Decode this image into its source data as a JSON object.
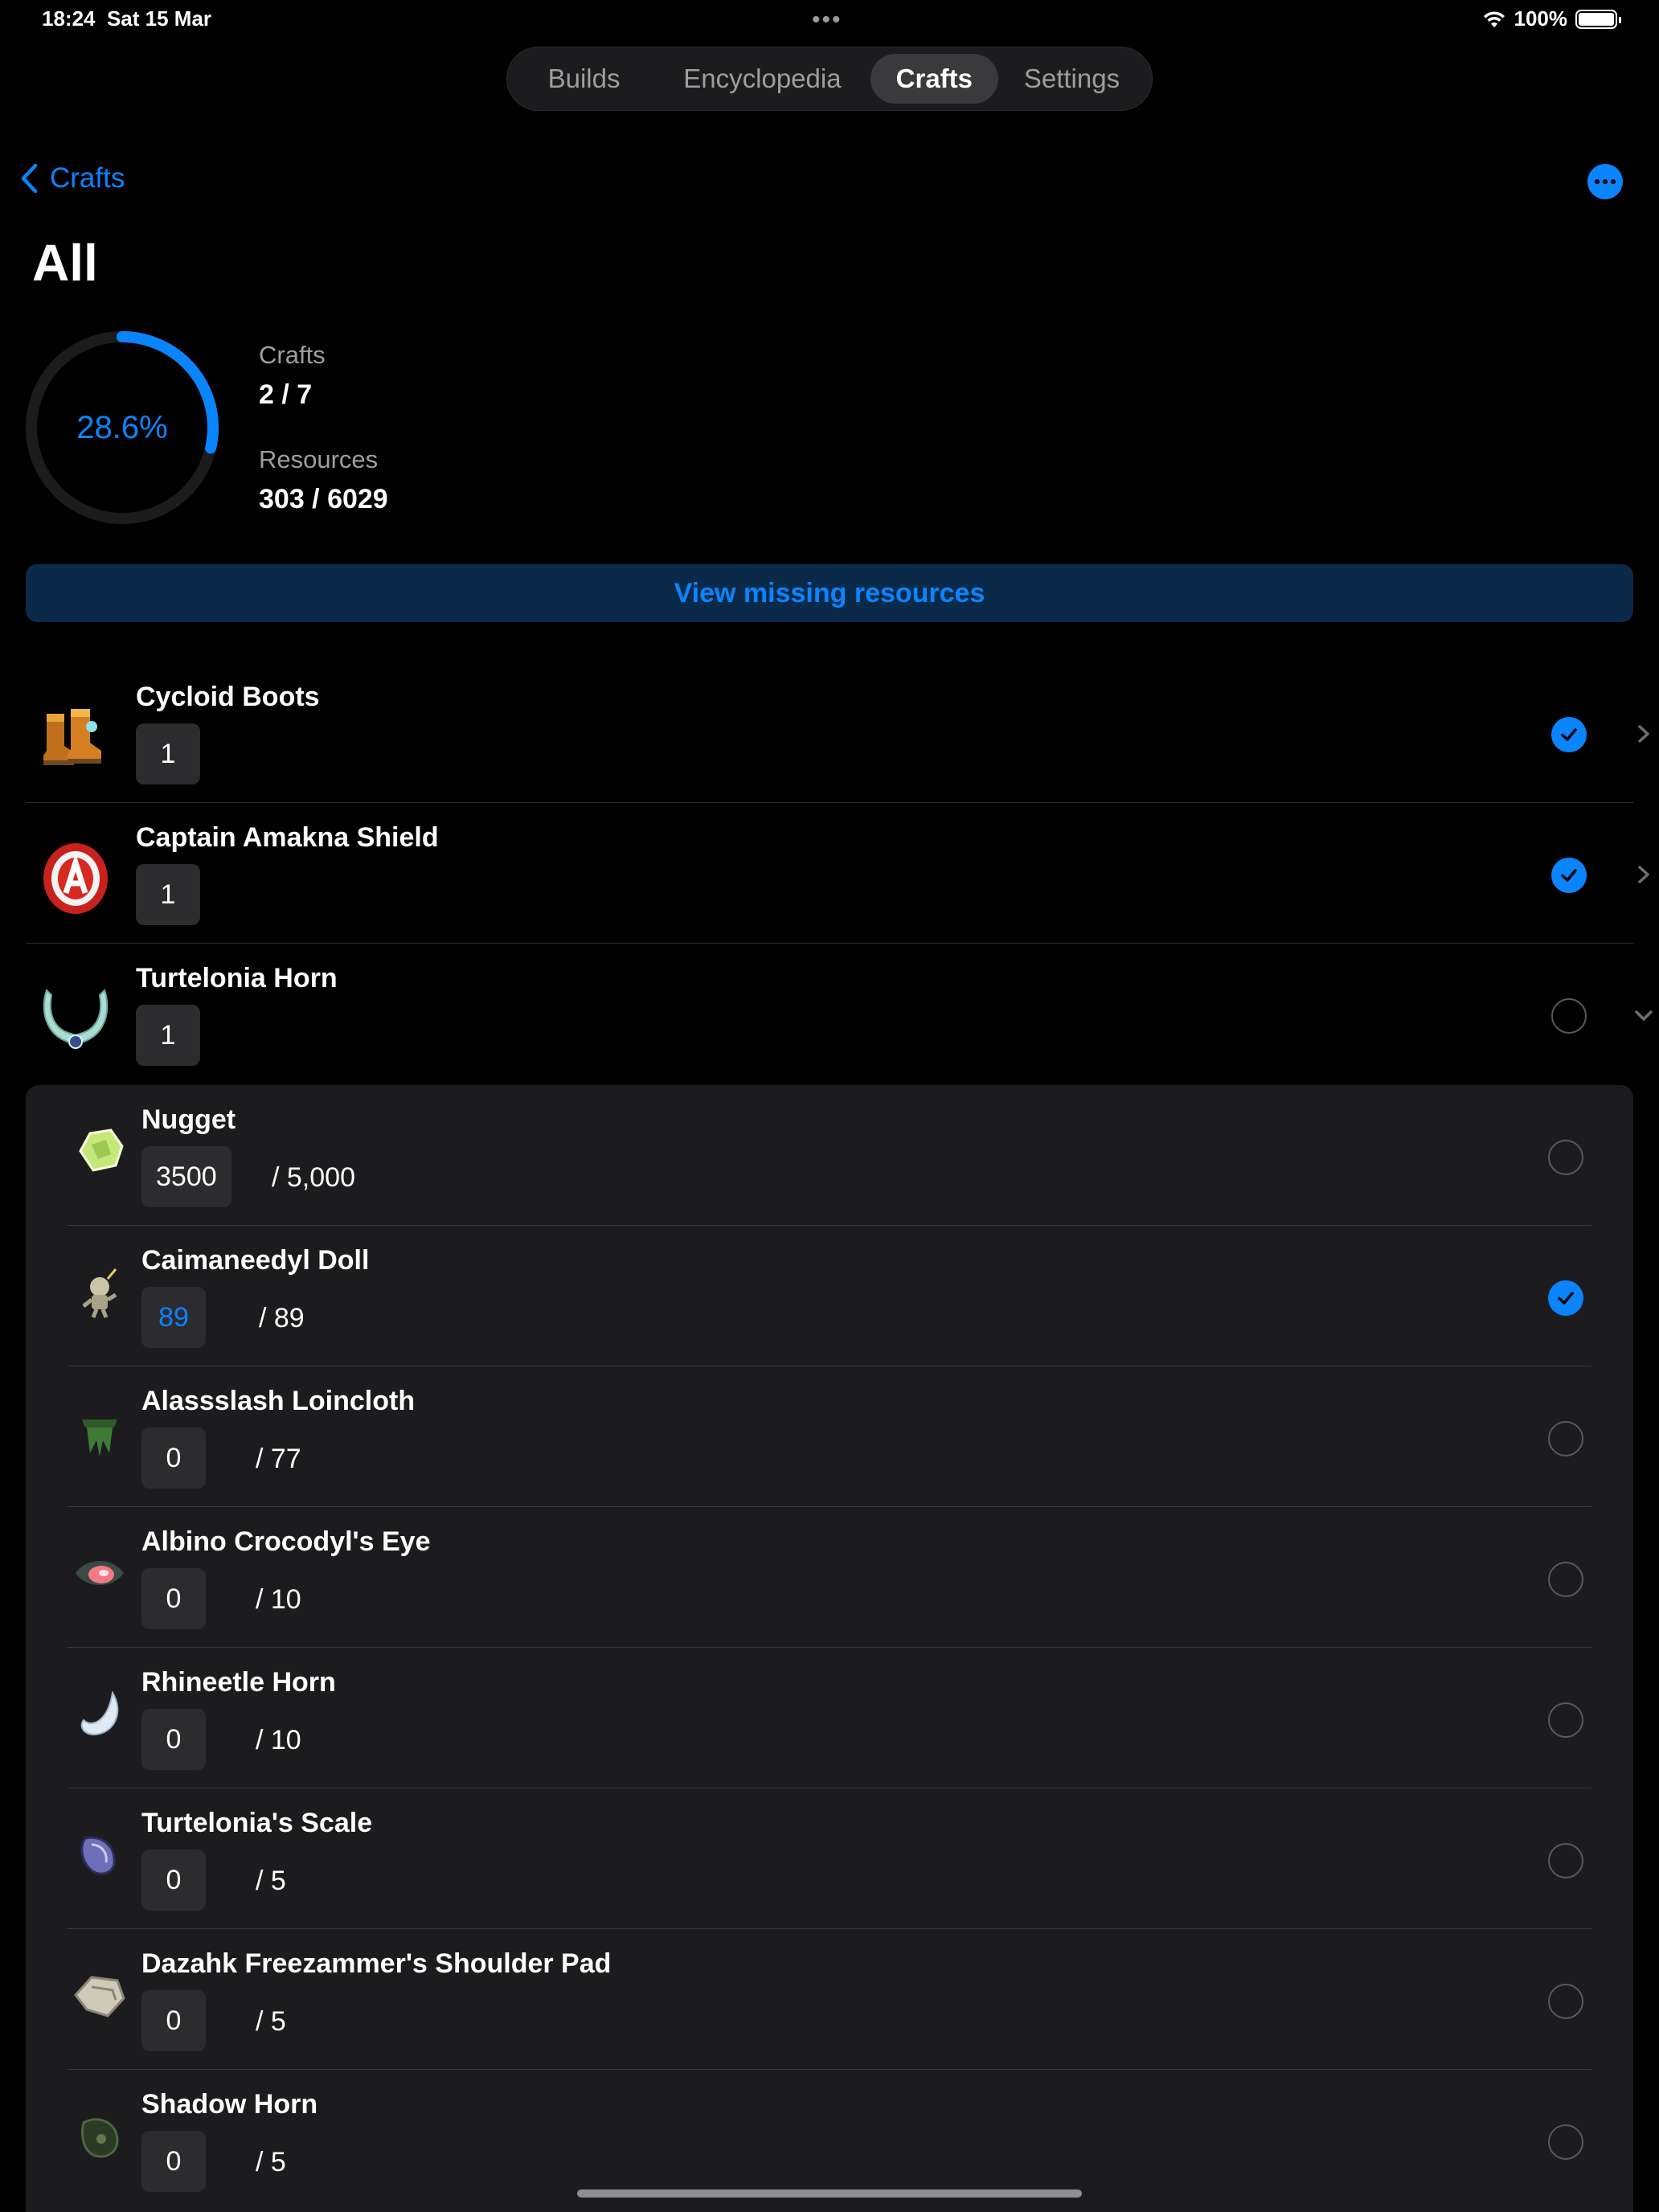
{
  "status_bar": {
    "time": "18:24",
    "date": "Sat 15 Mar",
    "battery": "100%"
  },
  "tabs": [
    {
      "label": "Builds",
      "active": false
    },
    {
      "label": "Encyclopedia",
      "active": false
    },
    {
      "label": "Crafts",
      "active": true
    },
    {
      "label": "Settings",
      "active": false
    }
  ],
  "nav": {
    "back_label": "Crafts",
    "title": "All"
  },
  "progress": {
    "percent_label": "28.6%",
    "fraction": 0.286,
    "crafts_label": "Crafts",
    "crafts_value": "2 / 7",
    "resources_label": "Resources",
    "resources_value": "303 / 6029"
  },
  "missing_button": "View missing resources",
  "items": [
    {
      "name": "Cycloid Boots",
      "qty": "1",
      "done": true,
      "expanded": false
    },
    {
      "name": "Captain Amakna Shield",
      "qty": "1",
      "done": true,
      "expanded": false
    },
    {
      "name": "Turtelonia Horn",
      "qty": "1",
      "done": false,
      "expanded": true
    }
  ],
  "resources": [
    {
      "name": "Nugget",
      "have": "3500",
      "need": "/ 5,000",
      "done": false
    },
    {
      "name": "Caimaneedyl Doll",
      "have": "89",
      "need": "/ 89",
      "done": true
    },
    {
      "name": "Alassslash Loincloth",
      "have": "0",
      "need": "/ 77",
      "done": false
    },
    {
      "name": "Albino Crocodyl's Eye",
      "have": "0",
      "need": "/ 10",
      "done": false
    },
    {
      "name": "Rhineetle Horn",
      "have": "0",
      "need": "/ 10",
      "done": false
    },
    {
      "name": "Turtelonia's Scale",
      "have": "0",
      "need": "/ 5",
      "done": false
    },
    {
      "name": "Dazahk Freezammer's Shoulder Pad",
      "have": "0",
      "need": "/ 5",
      "done": false
    },
    {
      "name": "Shadow Horn",
      "have": "0",
      "need": "/ 5",
      "done": false
    }
  ],
  "colors": {
    "accent": "#0a84ff",
    "background": "#000000",
    "panel": "#1c1c1e"
  }
}
